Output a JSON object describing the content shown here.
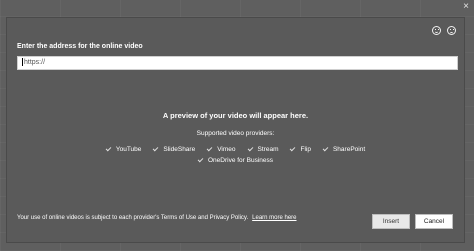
{
  "window": {
    "close_glyph": "×"
  },
  "dialog": {
    "address_label": "Enter the address for the online video",
    "url_value": "https://",
    "preview_message": "A preview of your video will appear here.",
    "providers_title": "Supported video providers:",
    "providers_row1": [
      "YouTube",
      "SlideShare",
      "Vimeo",
      "Stream",
      "Flip",
      "SharePoint"
    ],
    "providers_row2": [
      "OneDrive for Business"
    ],
    "terms_text": "Your use of online videos is subject to each provider's Terms of Use and Privacy Policy.",
    "learn_more": "Learn more here",
    "insert_label": "Insert",
    "cancel_label": "Cancel",
    "feedback_icons": [
      "smiley-happy-icon",
      "smiley-sad-icon"
    ]
  },
  "colors": {
    "dialog_bg": "#5a5a5a",
    "text": "#ffffff",
    "input_bg": "#ffffff"
  }
}
